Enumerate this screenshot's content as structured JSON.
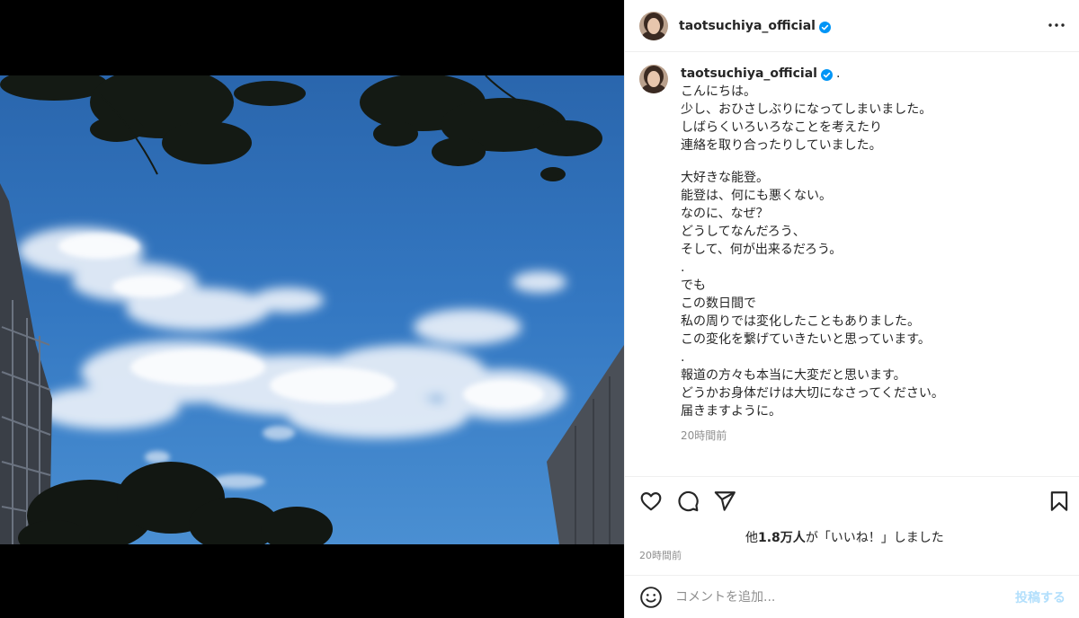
{
  "post": {
    "username": "taotsuchiya_official",
    "verified": true,
    "caption_suffix": ".",
    "caption_lines": [
      "こんにちは。",
      "少し、おひさしぶりになってしまいました。",
      "しばらくいろいろなことを考えたり",
      "連絡を取り合ったりしていました。",
      "",
      "大好きな能登。",
      "能登は、何にも悪くない。",
      "なのに、なぜ？",
      "どうしてなんだろう、",
      "そして、何が出来るだろう。",
      ".",
      "でも",
      "この数日間で",
      "私の周りでは変化したこともありました。",
      "この変化を繋げていきたいと思っています。",
      ".",
      "報道の方々も本当に大変だと思います。",
      "どうかお身体だけは大切になさってください。",
      "届きますように。"
    ],
    "caption_time": "20時間前",
    "likes_prefix": "他",
    "likes_count": "1.8万人",
    "likes_suffix": "が「いいね！」しました",
    "post_time": "20時間前"
  },
  "icons": {
    "more": "more-horizontal-icon",
    "like": "heart-icon",
    "comment": "comment-icon",
    "share": "paper-plane-icon",
    "save": "bookmark-icon",
    "emoji": "emoji-smile-icon",
    "verified": "verified-badge-icon"
  },
  "comment": {
    "placeholder": "コメントを追加...",
    "post_label": "投稿する"
  },
  "colors": {
    "verified": "#0095f6",
    "muted_text": "#8e8e8e",
    "post_button_disabled": "#b2dffc",
    "sky": "#2f6fb5"
  }
}
